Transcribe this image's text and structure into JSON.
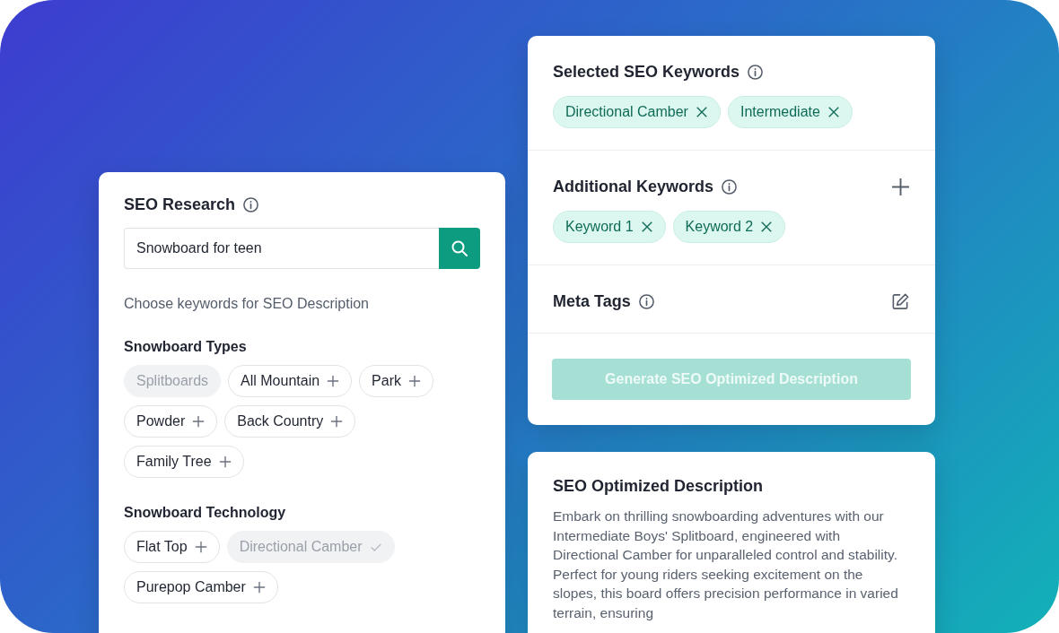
{
  "research": {
    "title": "SEO Research",
    "search": {
      "value": "Snowboard for teen"
    },
    "hint": "Choose keywords for SEO Description",
    "groups": [
      {
        "title": "Snowboard Types",
        "chips": [
          {
            "label": "Splitboards",
            "kind": "disabled"
          },
          {
            "label": "All Mountain",
            "kind": "add"
          },
          {
            "label": "Park",
            "kind": "add"
          },
          {
            "label": "Powder",
            "kind": "add"
          },
          {
            "label": "Back Country",
            "kind": "add"
          },
          {
            "label": "Family Tree",
            "kind": "add"
          }
        ]
      },
      {
        "title": "Snowboard Technology",
        "chips": [
          {
            "label": "Flat Top",
            "kind": "add"
          },
          {
            "label": "Directional Camber",
            "kind": "added"
          },
          {
            "label": "Purepop Camber",
            "kind": "add"
          }
        ]
      }
    ]
  },
  "keywords": {
    "sections": [
      {
        "title": "Selected SEO Keywords",
        "kind": "chips",
        "chips": [
          "Directional Camber",
          "Intermediate"
        ]
      },
      {
        "title": "Additional Keywords",
        "kind": "add",
        "chips": [
          "Keyword 1",
          "Keyword 2"
        ]
      },
      {
        "title": "Meta Tags",
        "kind": "edit"
      }
    ],
    "button": {
      "label": "Generate SEO Optimized Description",
      "disabled": true
    }
  },
  "description": {
    "title": "SEO Optimized Description",
    "text": "Embark on thrilling snowboarding adventures with our Intermediate Boys' Splitboard, engineered with Directional Camber for unparalleled control and stability. Perfect for young riders seeking excitement on the slopes, this board offers precision performance in varied terrain, ensuring"
  }
}
